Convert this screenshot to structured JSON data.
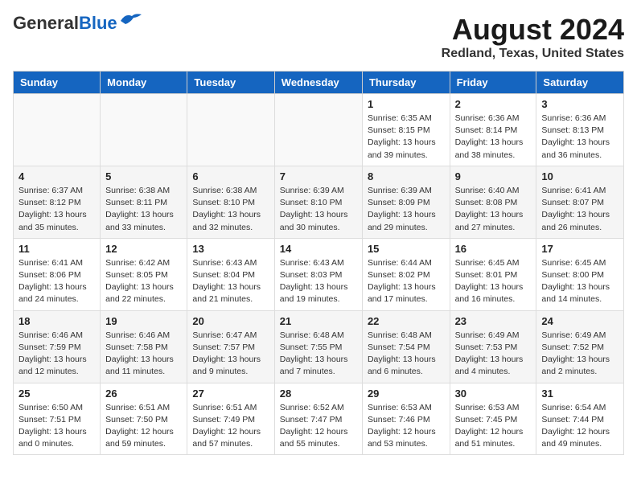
{
  "header": {
    "logo_general": "General",
    "logo_blue": "Blue",
    "month_title": "August 2024",
    "location": "Redland, Texas, United States"
  },
  "weekdays": [
    "Sunday",
    "Monday",
    "Tuesday",
    "Wednesday",
    "Thursday",
    "Friday",
    "Saturday"
  ],
  "weeks": [
    {
      "days": [
        {
          "num": "",
          "info": ""
        },
        {
          "num": "",
          "info": ""
        },
        {
          "num": "",
          "info": ""
        },
        {
          "num": "",
          "info": ""
        },
        {
          "num": "1",
          "info": "Sunrise: 6:35 AM\nSunset: 8:15 PM\nDaylight: 13 hours\nand 39 minutes."
        },
        {
          "num": "2",
          "info": "Sunrise: 6:36 AM\nSunset: 8:14 PM\nDaylight: 13 hours\nand 38 minutes."
        },
        {
          "num": "3",
          "info": "Sunrise: 6:36 AM\nSunset: 8:13 PM\nDaylight: 13 hours\nand 36 minutes."
        }
      ]
    },
    {
      "days": [
        {
          "num": "4",
          "info": "Sunrise: 6:37 AM\nSunset: 8:12 PM\nDaylight: 13 hours\nand 35 minutes."
        },
        {
          "num": "5",
          "info": "Sunrise: 6:38 AM\nSunset: 8:11 PM\nDaylight: 13 hours\nand 33 minutes."
        },
        {
          "num": "6",
          "info": "Sunrise: 6:38 AM\nSunset: 8:10 PM\nDaylight: 13 hours\nand 32 minutes."
        },
        {
          "num": "7",
          "info": "Sunrise: 6:39 AM\nSunset: 8:10 PM\nDaylight: 13 hours\nand 30 minutes."
        },
        {
          "num": "8",
          "info": "Sunrise: 6:39 AM\nSunset: 8:09 PM\nDaylight: 13 hours\nand 29 minutes."
        },
        {
          "num": "9",
          "info": "Sunrise: 6:40 AM\nSunset: 8:08 PM\nDaylight: 13 hours\nand 27 minutes."
        },
        {
          "num": "10",
          "info": "Sunrise: 6:41 AM\nSunset: 8:07 PM\nDaylight: 13 hours\nand 26 minutes."
        }
      ]
    },
    {
      "days": [
        {
          "num": "11",
          "info": "Sunrise: 6:41 AM\nSunset: 8:06 PM\nDaylight: 13 hours\nand 24 minutes."
        },
        {
          "num": "12",
          "info": "Sunrise: 6:42 AM\nSunset: 8:05 PM\nDaylight: 13 hours\nand 22 minutes."
        },
        {
          "num": "13",
          "info": "Sunrise: 6:43 AM\nSunset: 8:04 PM\nDaylight: 13 hours\nand 21 minutes."
        },
        {
          "num": "14",
          "info": "Sunrise: 6:43 AM\nSunset: 8:03 PM\nDaylight: 13 hours\nand 19 minutes."
        },
        {
          "num": "15",
          "info": "Sunrise: 6:44 AM\nSunset: 8:02 PM\nDaylight: 13 hours\nand 17 minutes."
        },
        {
          "num": "16",
          "info": "Sunrise: 6:45 AM\nSunset: 8:01 PM\nDaylight: 13 hours\nand 16 minutes."
        },
        {
          "num": "17",
          "info": "Sunrise: 6:45 AM\nSunset: 8:00 PM\nDaylight: 13 hours\nand 14 minutes."
        }
      ]
    },
    {
      "days": [
        {
          "num": "18",
          "info": "Sunrise: 6:46 AM\nSunset: 7:59 PM\nDaylight: 13 hours\nand 12 minutes."
        },
        {
          "num": "19",
          "info": "Sunrise: 6:46 AM\nSunset: 7:58 PM\nDaylight: 13 hours\nand 11 minutes."
        },
        {
          "num": "20",
          "info": "Sunrise: 6:47 AM\nSunset: 7:57 PM\nDaylight: 13 hours\nand 9 minutes."
        },
        {
          "num": "21",
          "info": "Sunrise: 6:48 AM\nSunset: 7:55 PM\nDaylight: 13 hours\nand 7 minutes."
        },
        {
          "num": "22",
          "info": "Sunrise: 6:48 AM\nSunset: 7:54 PM\nDaylight: 13 hours\nand 6 minutes."
        },
        {
          "num": "23",
          "info": "Sunrise: 6:49 AM\nSunset: 7:53 PM\nDaylight: 13 hours\nand 4 minutes."
        },
        {
          "num": "24",
          "info": "Sunrise: 6:49 AM\nSunset: 7:52 PM\nDaylight: 13 hours\nand 2 minutes."
        }
      ]
    },
    {
      "days": [
        {
          "num": "25",
          "info": "Sunrise: 6:50 AM\nSunset: 7:51 PM\nDaylight: 13 hours\nand 0 minutes."
        },
        {
          "num": "26",
          "info": "Sunrise: 6:51 AM\nSunset: 7:50 PM\nDaylight: 12 hours\nand 59 minutes."
        },
        {
          "num": "27",
          "info": "Sunrise: 6:51 AM\nSunset: 7:49 PM\nDaylight: 12 hours\nand 57 minutes."
        },
        {
          "num": "28",
          "info": "Sunrise: 6:52 AM\nSunset: 7:47 PM\nDaylight: 12 hours\nand 55 minutes."
        },
        {
          "num": "29",
          "info": "Sunrise: 6:53 AM\nSunset: 7:46 PM\nDaylight: 12 hours\nand 53 minutes."
        },
        {
          "num": "30",
          "info": "Sunrise: 6:53 AM\nSunset: 7:45 PM\nDaylight: 12 hours\nand 51 minutes."
        },
        {
          "num": "31",
          "info": "Sunrise: 6:54 AM\nSunset: 7:44 PM\nDaylight: 12 hours\nand 49 minutes."
        }
      ]
    }
  ]
}
